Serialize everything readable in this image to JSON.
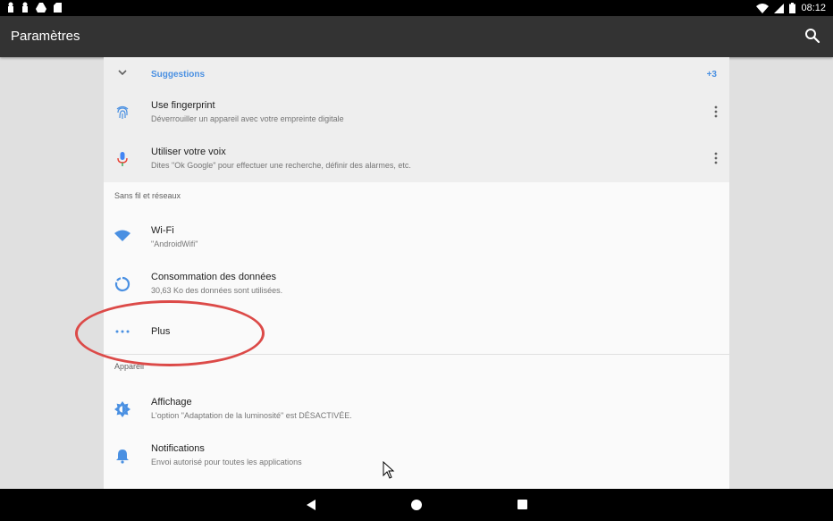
{
  "status_bar": {
    "time": "08:12",
    "left_icons": [
      "notification-icon",
      "notification-icon",
      "drive-icon",
      "sdcard-icon"
    ],
    "right_icons": [
      "wifi-icon",
      "signal-icon",
      "battery-icon"
    ]
  },
  "toolbar": {
    "title": "Paramètres",
    "search_icon": "search-icon"
  },
  "suggestions": {
    "label": "Suggestions",
    "count": "+3",
    "items": [
      {
        "title": "Use fingerprint",
        "subtitle": "Déverrouiller un appareil avec votre empreinte digitale",
        "icon": "fingerprint-icon"
      },
      {
        "title": "Utiliser votre voix",
        "subtitle": "Dites \"Ok Google\" pour effectuer une recherche, définir des alarmes, etc.",
        "icon": "microphone-icon"
      }
    ]
  },
  "sections": [
    {
      "title": "Sans fil et réseaux",
      "items": [
        {
          "title": "Wi-Fi",
          "subtitle": "\"AndroidWifi\"",
          "icon": "wifi-icon"
        },
        {
          "title": "Consommation des données",
          "subtitle": "30,63 Ko des données sont utilisées.",
          "icon": "data-usage-icon"
        },
        {
          "title": "Plus",
          "subtitle": "",
          "icon": "more-horiz-icon"
        }
      ]
    },
    {
      "title": "Appareil",
      "items": [
        {
          "title": "Affichage",
          "subtitle": "L'option \"Adaptation de la luminosité\" est DÉSACTIVÉE.",
          "icon": "brightness-icon"
        },
        {
          "title": "Notifications",
          "subtitle": "Envoi autorisé pour toutes les applications",
          "icon": "bell-icon"
        }
      ]
    }
  ],
  "colors": {
    "accent": "#4a90e2",
    "toolbar": "#333333",
    "annotation": "#dc4a48"
  }
}
